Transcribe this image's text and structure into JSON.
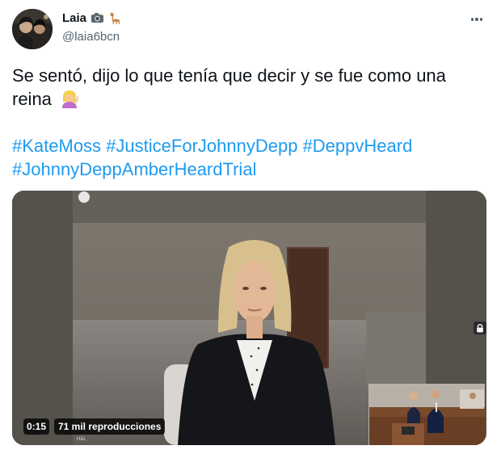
{
  "tweet": {
    "display_name": "Laia",
    "name_emojis": [
      "camera-with-flash-icon",
      "llama-icon"
    ],
    "handle": "@laia6bcn",
    "text_line1": "Se sentó, dijo lo que tenía que decir y se fue como una",
    "text_line2": "reina",
    "text_emoji": "woman-tipping-hand-icon",
    "hashtags_row1": [
      "#KateMoss",
      "#JusticeForJohnnyDepp",
      "#DeppvHeard"
    ],
    "hashtags_row2": [
      "#JohnnyDeppAmberHeardTrial"
    ]
  },
  "media": {
    "duration": "0:15",
    "views": "71 mil reproducciones",
    "watermark_bottom": "H&L"
  },
  "colors": {
    "link": "#1d9bf0",
    "text": "#0f1419",
    "secondary": "#536471"
  }
}
